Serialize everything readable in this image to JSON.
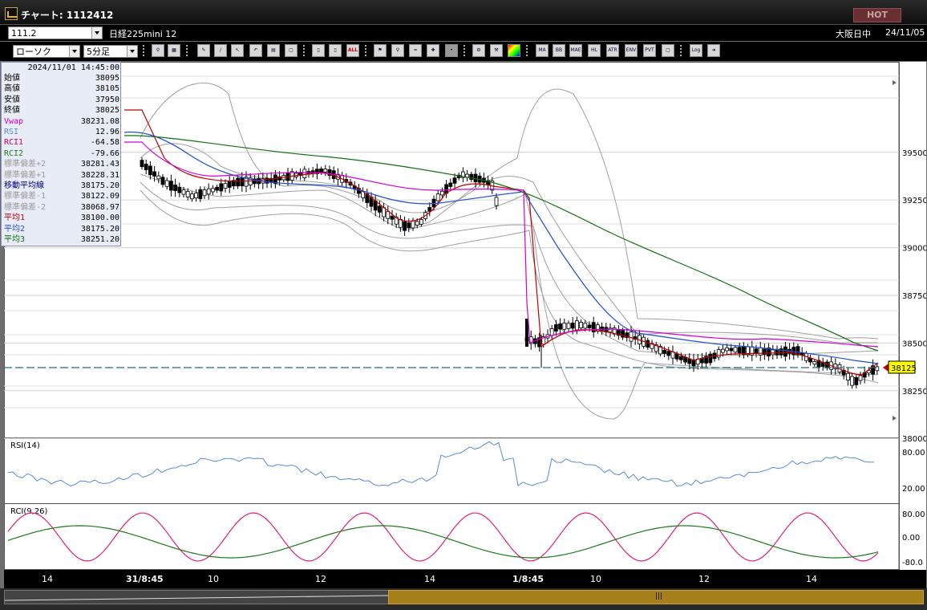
{
  "window": {
    "title": "チャート: 1112412",
    "hot_label": "HOT"
  },
  "infobar": {
    "code": "111.2",
    "name": "日経225mini 12",
    "exchange": "大阪日中",
    "date": "24/11/05"
  },
  "toolbar": {
    "chart_type": "ローソク",
    "interval": "5分足",
    "buttons": [
      "ALL",
      "MA",
      "BB",
      "MAE",
      "HL",
      "ATR",
      "ENV",
      "PVT",
      "Log"
    ]
  },
  "info_panel": {
    "datetime": "2024/11/01 14:45:00",
    "rows": [
      {
        "label": "始値",
        "value": "38095",
        "color": "#000000"
      },
      {
        "label": "高値",
        "value": "38105",
        "color": "#000000"
      },
      {
        "label": "安値",
        "value": "37950",
        "color": "#000000"
      },
      {
        "label": "終値",
        "value": "38025",
        "color": "#000000"
      },
      {
        "label": "Vwap",
        "value": "38231.08",
        "color": "#d000d0"
      },
      {
        "label": "RSI",
        "value": "12.96",
        "color": "#5a8ad8"
      },
      {
        "label": "RCI1",
        "value": "-64.58",
        "color": "#d0006a"
      },
      {
        "label": "RCI2",
        "value": "-79.66",
        "color": "#1c7a1c"
      },
      {
        "label": "標準偏差+2",
        "value": "38281.43",
        "color": "#9a9a9a"
      },
      {
        "label": "標準偏差+1",
        "value": "38228.31",
        "color": "#9a9a9a"
      },
      {
        "label": "移動平均線",
        "value": "38175.20",
        "color": "#000080"
      },
      {
        "label": "標準偏差-1",
        "value": "38122.09",
        "color": "#9a9a9a"
      },
      {
        "label": "標準偏差-2",
        "value": "38068.97",
        "color": "#9a9a9a"
      },
      {
        "label": "平均1",
        "value": "38100.00",
        "color": "#c00000"
      },
      {
        "label": "平均2",
        "value": "38175.20",
        "color": "#2050d0"
      },
      {
        "label": "平均3",
        "value": "38251.20",
        "color": "#107010"
      }
    ]
  },
  "price_axis": {
    "ticks": [
      "39500",
      "39250",
      "39000",
      "38750",
      "38500",
      "38250",
      "38000"
    ],
    "current_price": "38125"
  },
  "rsi_panel": {
    "title": "RSI(14)",
    "ticks": [
      "80.00",
      "20.00"
    ]
  },
  "rci_panel": {
    "title": "RCI(9,26)",
    "ticks": [
      "80.00",
      "0.00",
      "-80.0"
    ]
  },
  "time_axis": {
    "labels": [
      "14",
      "31/8:45",
      "10",
      "12",
      "14",
      "1/8:45",
      "10",
      "12",
      "14"
    ]
  },
  "colors": {
    "candle_up": "#ffffff",
    "candle_down": "#000000",
    "ma_short": "#c00000",
    "ma_mid": "#2050d0",
    "ma_long": "#107010",
    "vwap": "#d000d0",
    "bands": "#a0a0a0",
    "rsi": "#5a8ad8",
    "rci1": "#e0207a",
    "rci2": "#1c7a1c",
    "price_marker": "#ffff00"
  }
}
